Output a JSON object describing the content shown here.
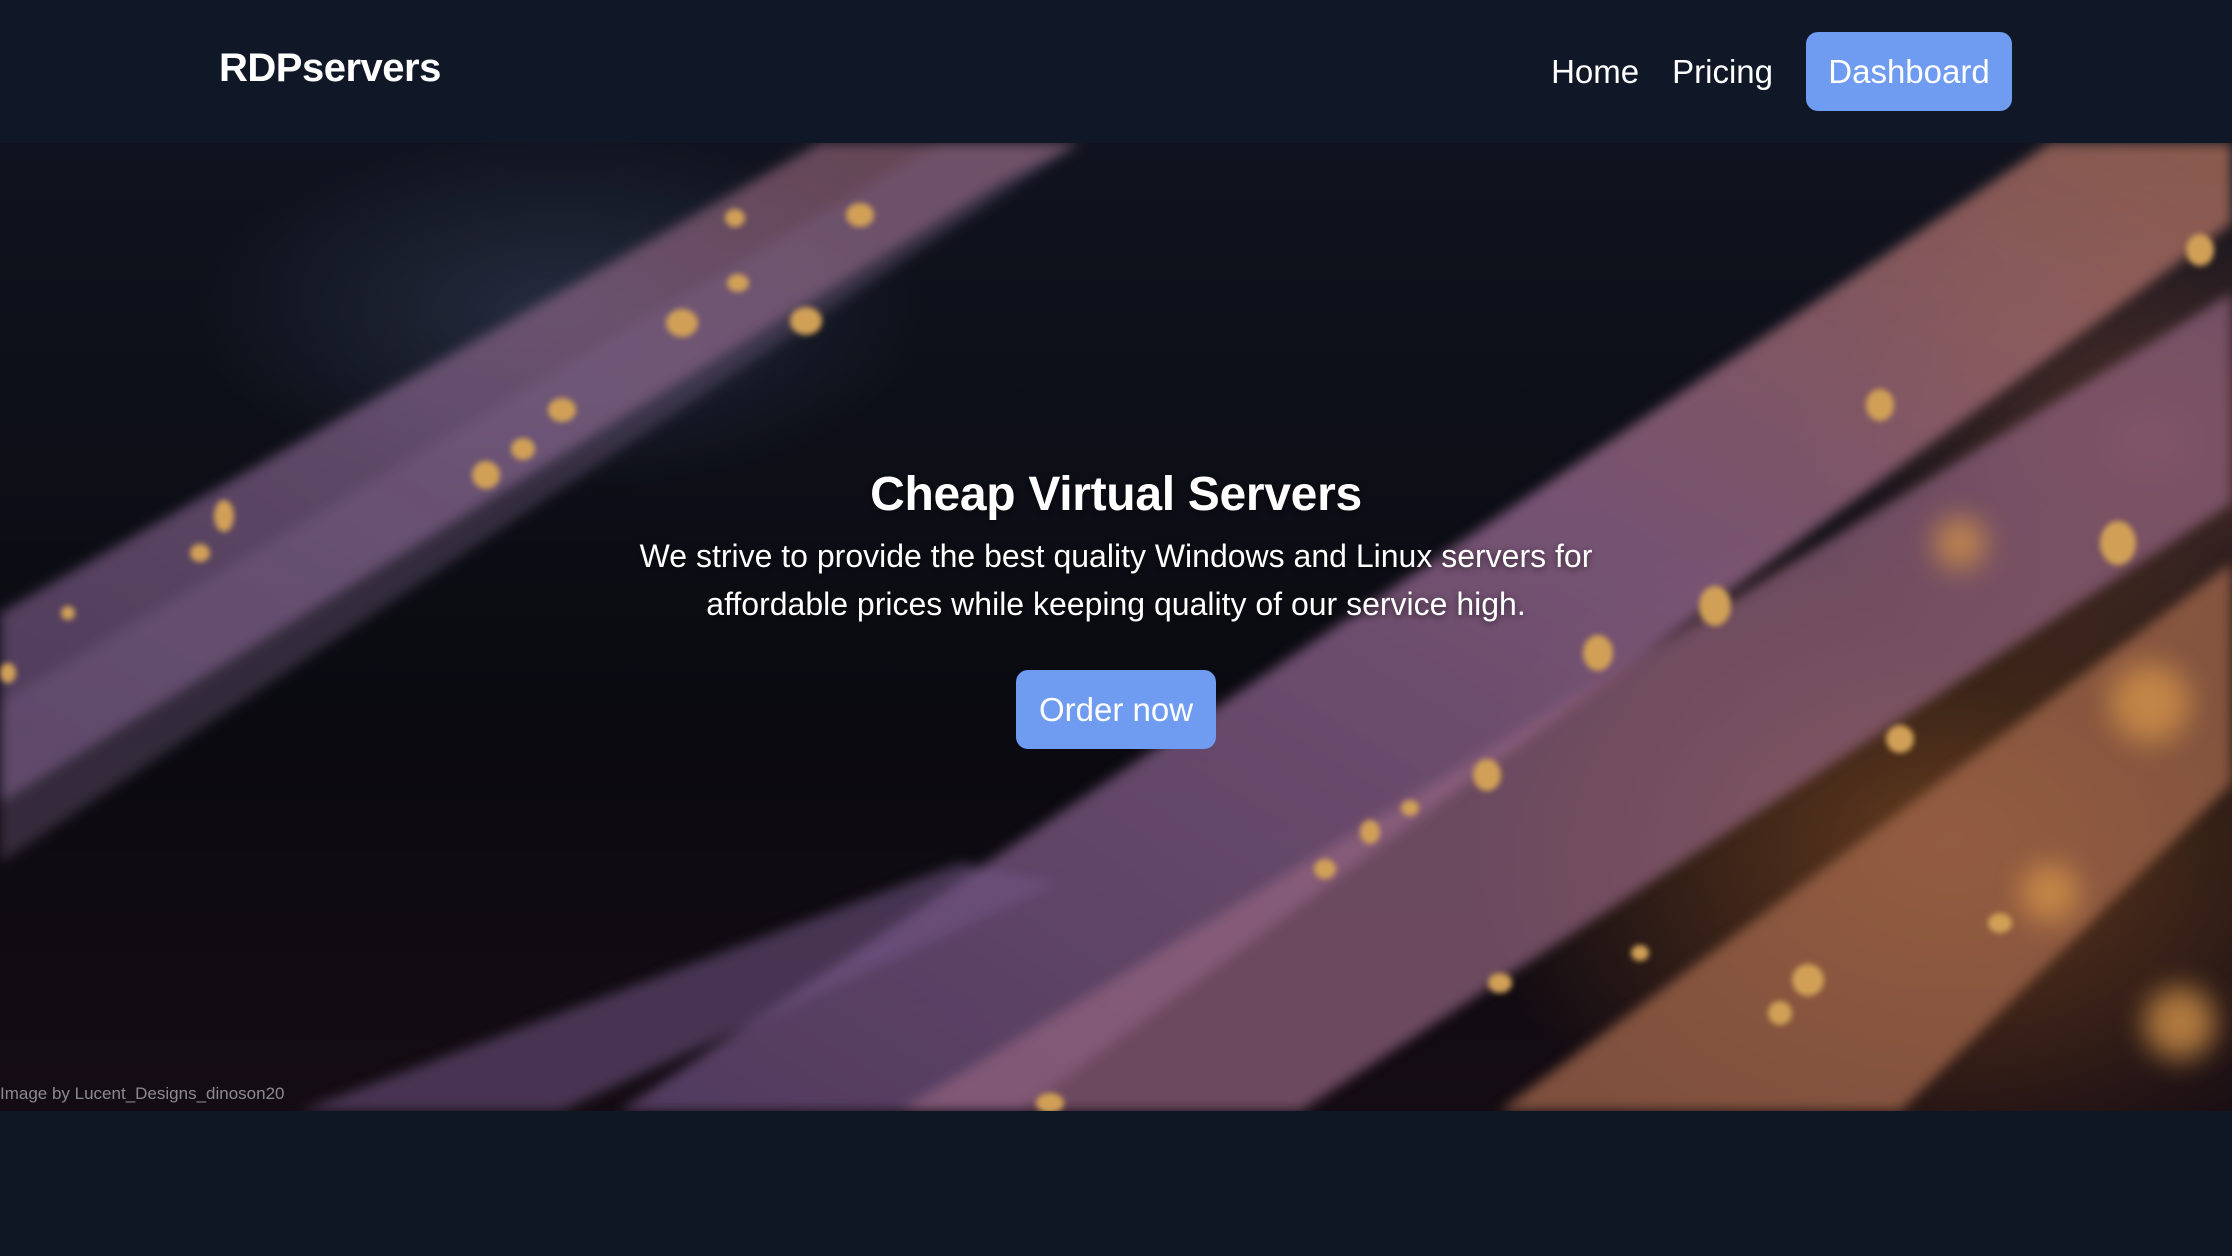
{
  "navbar": {
    "brand": "RDPservers",
    "links": [
      {
        "label": "Home"
      },
      {
        "label": "Pricing"
      }
    ],
    "dashboard_label": "Dashboard"
  },
  "hero": {
    "title": "Cheap Virtual Servers",
    "description": "We strive to provide the best quality Windows and Linux servers for affordable prices while keeping quality of our service high.",
    "cta_label": "Order now",
    "image_credit": "Image by Lucent_Designs_dinoson20"
  },
  "colors": {
    "background": "#0f1624",
    "accent": "#6f9cf0",
    "text": "#ffffff"
  }
}
